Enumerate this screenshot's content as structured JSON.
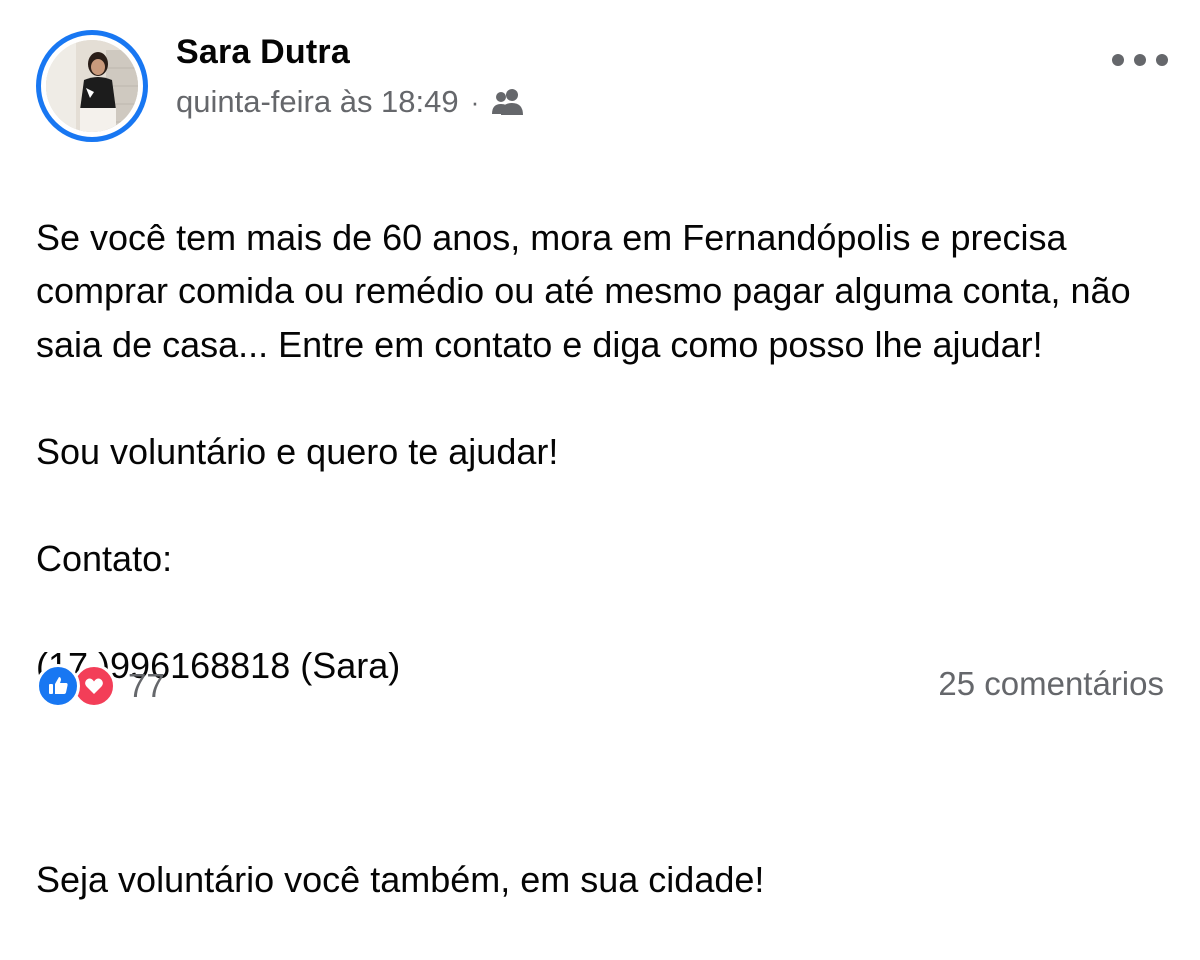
{
  "post": {
    "author": {
      "name": "Sara Dutra"
    },
    "timestamp": "quinta-feira às 18:49",
    "separator": "·",
    "audience_icon": "friends-icon",
    "more_icon": "more-horizontal-icon",
    "body": {
      "line1": "Se você tem mais de 60 anos, mora em Fernandópolis e precisa comprar comida ou remédio ou até mesmo pagar alguma conta, não saia de casa... Entre em contato e diga como posso lhe ajudar!",
      "line2": "Sou voluntário e quero te ajudar!",
      "line3": "Contato:",
      "line4": "(17 )996168818 (Sara)",
      "line5": "Seja voluntário você também, em sua cidade!"
    },
    "reactions": {
      "icons": [
        "like-icon",
        "love-icon"
      ],
      "count": "77"
    },
    "comments": {
      "label": "25 comentários"
    }
  },
  "colors": {
    "accent": "#1877f2",
    "love": "#f33e58",
    "secondary_text": "#65676b",
    "primary_text": "#050505"
  }
}
